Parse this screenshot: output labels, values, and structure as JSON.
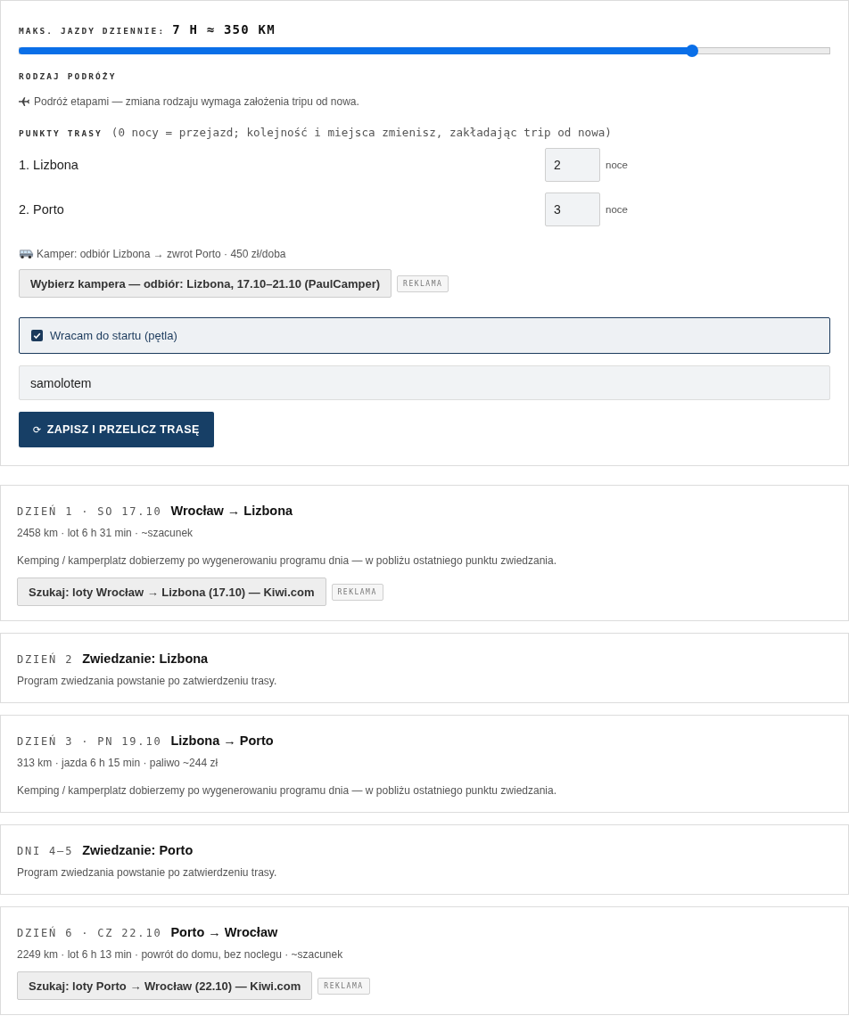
{
  "max_drive": {
    "label": "MAKS. JAZDY DZIENNIE:",
    "value": "7 H ≈ 350 KM",
    "level": 0.83
  },
  "trip_type": {
    "label": "RODZAJ PODRÓŻY",
    "note": "Podróż etapami — zmiana rodzaju wymaga założenia tripu od nowa."
  },
  "route_points": {
    "label": "PUNKTY TRASY",
    "hint": "(0 nocy = przejazd; kolejność i miejsca zmienisz, zakładając trip od nowa)",
    "items": [
      {
        "name": "1. Lizbona",
        "nights": "2",
        "unit": "noce"
      },
      {
        "name": "2. Porto",
        "nights": "3",
        "unit": "noce"
      }
    ]
  },
  "camper": {
    "info": "Kamper: odbiór Lizbona → zwrot Porto · 450 zł/doba",
    "button": "Wybierz kampera — odbiór: Lizbona, 17.10–21.10 (PaulCamper)",
    "badge": "REKLAMA"
  },
  "return_loop": {
    "label": "Wracam do startu (pętla)",
    "checked": true
  },
  "return_mode": {
    "value": "samolotem"
  },
  "save_button": {
    "icon": "⟳",
    "label": "ZAPISZ I PRZELICZ TRASĘ"
  },
  "days": [
    {
      "label": "DZIEŃ 1 · SO 17.10",
      "title": "Wrocław → Lizbona",
      "meta": "2458 km · lot 6 h 31 min · ~szacunek",
      "note": "Kemping / kamperplatz dobierzemy po wygenerowaniu programu dnia — w pobliżu ostatniego punktu zwiedzania.",
      "link": {
        "label": "Szukaj: loty Wrocław → Lizbona (17.10) — Kiwi.com",
        "badge": "REKLAMA"
      }
    },
    {
      "label": "DZIEŃ 2",
      "title": "Zwiedzanie: Lizbona",
      "meta": "Program zwiedzania powstanie po zatwierdzeniu trasy."
    },
    {
      "label": "DZIEŃ 3 · PN 19.10",
      "title": "Lizbona → Porto",
      "meta": "313 km · jazda 6 h 15 min · paliwo ~244 zł",
      "note": "Kemping / kamperplatz dobierzemy po wygenerowaniu programu dnia — w pobliżu ostatniego punktu zwiedzania."
    },
    {
      "label": "DNI 4–5",
      "title": "Zwiedzanie: Porto",
      "meta": "Program zwiedzania powstanie po zatwierdzeniu trasy."
    },
    {
      "label": "DZIEŃ 6 · CZ 22.10",
      "title": "Porto → Wrocław",
      "meta": "2249 km · lot 6 h 13 min · powrót do domu, bez noclegu · ~szacunek",
      "link": {
        "label": "Szukaj: loty Porto → Wrocław (22.10) — Kiwi.com",
        "badge": "REKLAMA"
      }
    }
  ]
}
